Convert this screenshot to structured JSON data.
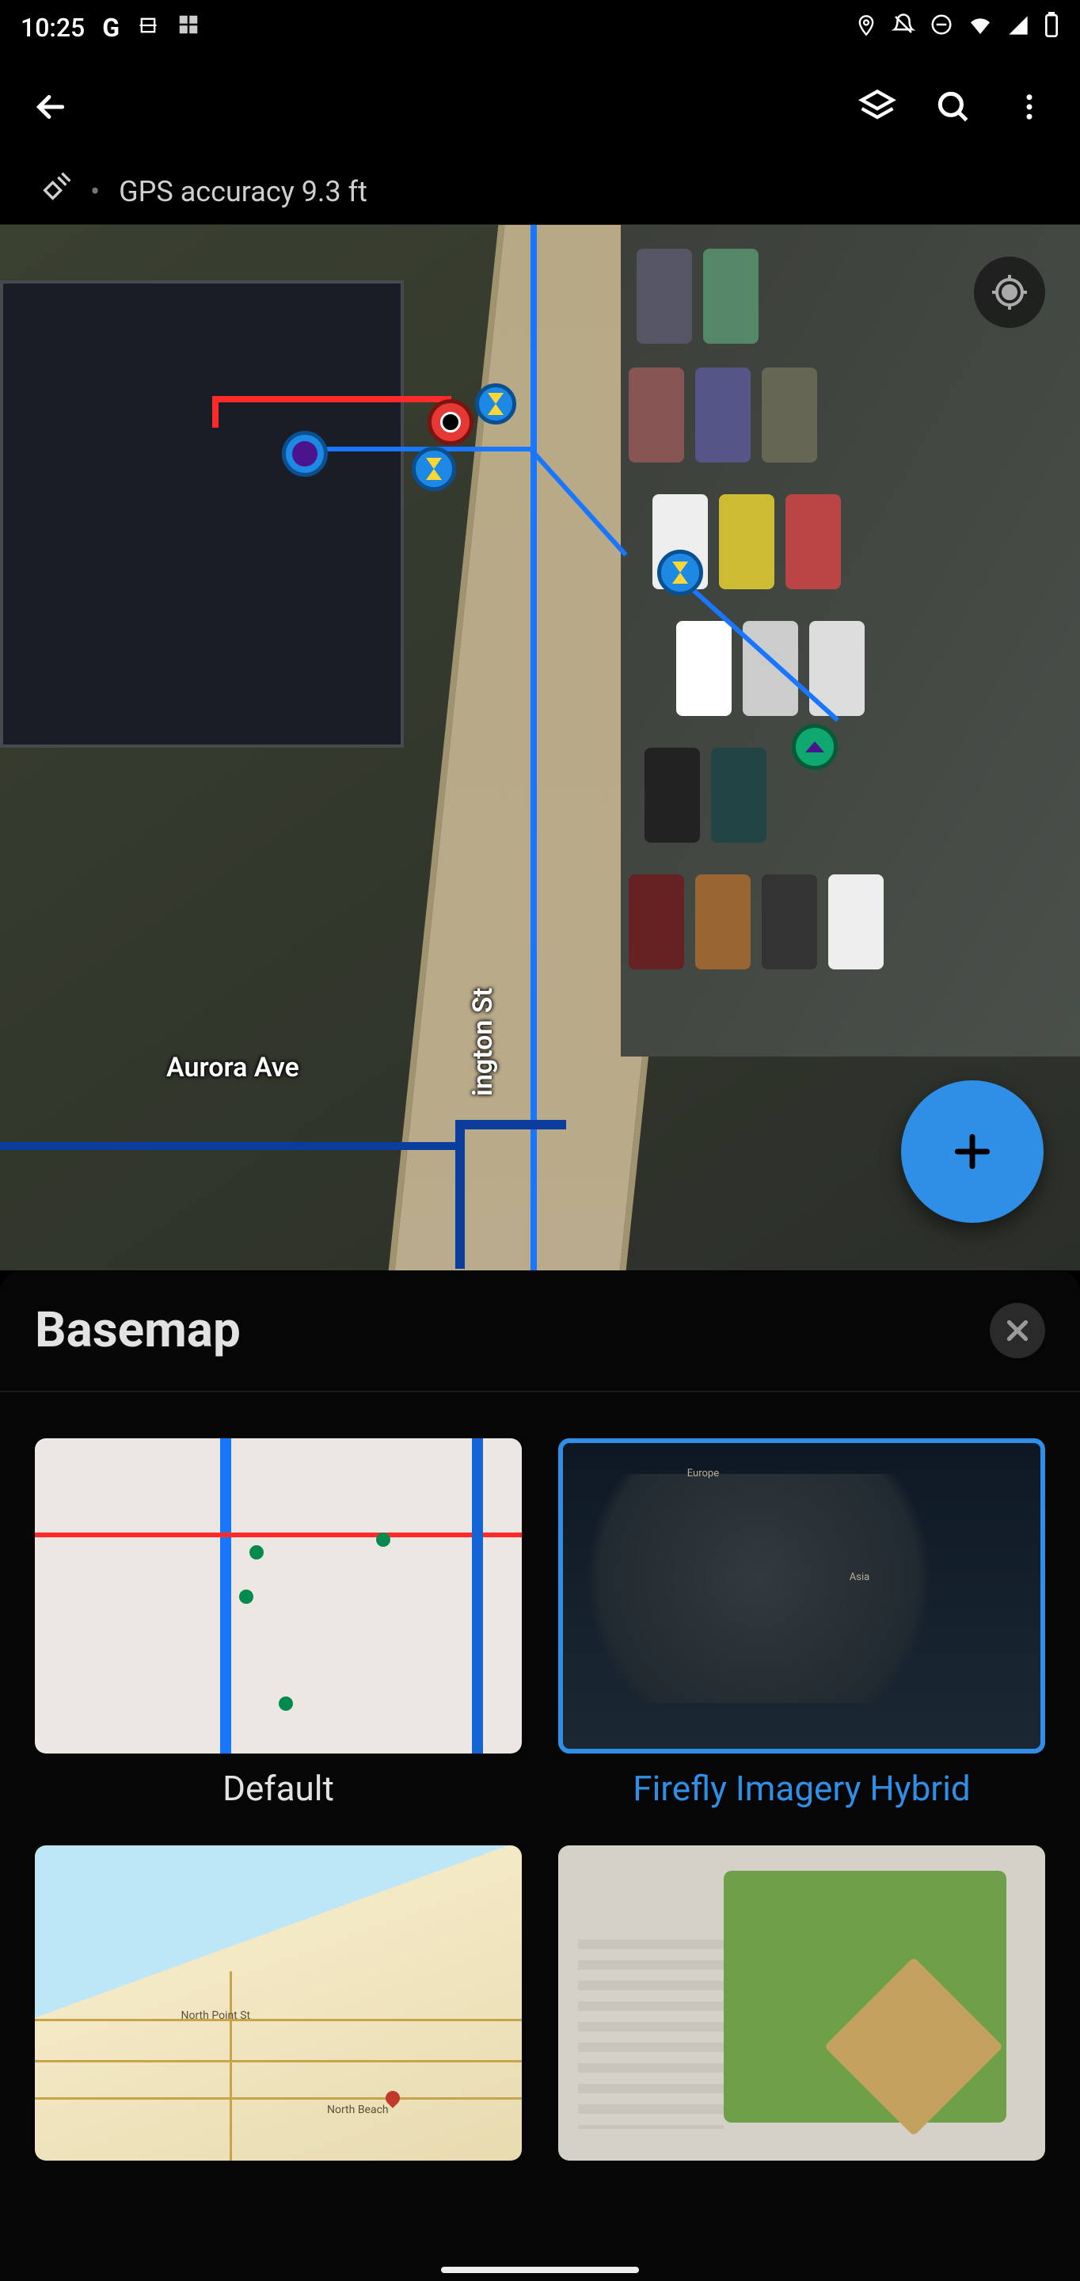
{
  "status": {
    "time": "10:25"
  },
  "accuracy": {
    "text": "GPS accuracy 9.3 ft"
  },
  "map": {
    "street1": "Aurora Ave",
    "street2": "ington St"
  },
  "sheet": {
    "title": "Basemap",
    "options": [
      {
        "label": "Default",
        "selected": false
      },
      {
        "label": "Firefly Imagery Hybrid",
        "selected": true
      },
      {
        "label": "",
        "selected": false
      },
      {
        "label": "",
        "selected": false
      }
    ]
  }
}
